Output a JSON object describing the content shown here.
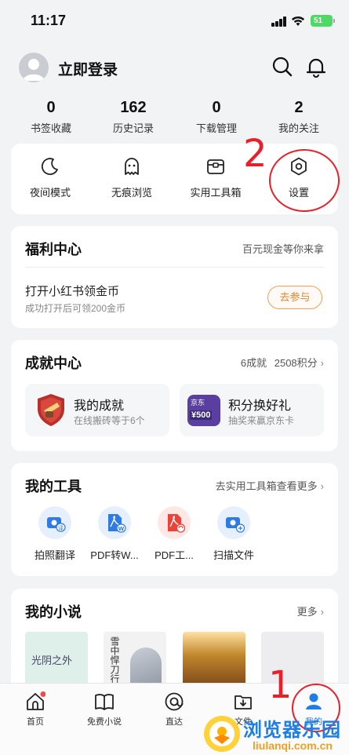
{
  "status_bar": {
    "time": "11:17",
    "battery": "51"
  },
  "header": {
    "login_label": "立即登录"
  },
  "stats": [
    {
      "num": "0",
      "label": "书签收藏"
    },
    {
      "num": "162",
      "label": "历史记录"
    },
    {
      "num": "0",
      "label": "下载管理"
    },
    {
      "num": "2",
      "label": "我的关注"
    }
  ],
  "quick": [
    {
      "label": "夜间模式",
      "icon": "moon-icon"
    },
    {
      "label": "无痕浏览",
      "icon": "ghost-icon"
    },
    {
      "label": "实用工具箱",
      "icon": "toolbox-icon"
    },
    {
      "label": "设置",
      "icon": "settings-hexagon-icon"
    }
  ],
  "welfare": {
    "title": "福利中心",
    "right": "百元现金等你来拿",
    "task_title": "打开小红书领金币",
    "task_sub": "成功打开后可领200金币",
    "button": "去参与"
  },
  "achievements": {
    "title": "成就中心",
    "count": "6成就",
    "points": "2508积分",
    "items": [
      {
        "title": "我的成就",
        "sub": "在线搬砖等于6个"
      },
      {
        "title": "积分换好礼",
        "sub": "抽奖来赢京东卡",
        "card_brand": "京东",
        "card_value": "¥500"
      }
    ]
  },
  "tools": {
    "title": "我的工具",
    "right": "去实用工具箱查看更多",
    "items": [
      {
        "label": "拍照翻译",
        "badge": "译",
        "icon": "camera-translate-icon"
      },
      {
        "label": "PDF转W...",
        "badge": "W",
        "icon": "pdf-to-word-icon"
      },
      {
        "label": "PDF工...",
        "badge": "",
        "icon": "pdf-tools-icon"
      },
      {
        "label": "扫描文件",
        "badge": "",
        "icon": "scan-file-icon"
      }
    ]
  },
  "novels": {
    "title": "我的小说",
    "right": "更多",
    "books": [
      {
        "title": "光阴之外"
      },
      {
        "title": "雪中悍刀行"
      },
      {
        "title": ""
      },
      {
        "title": ""
      }
    ]
  },
  "tabbar": [
    {
      "label": "首页",
      "icon": "home-icon"
    },
    {
      "label": "免费小说",
      "icon": "book-icon"
    },
    {
      "label": "直达",
      "icon": "direct-icon"
    },
    {
      "label": "文件",
      "icon": "download-folder-icon"
    },
    {
      "label": "我的",
      "icon": "profile-icon"
    }
  ],
  "annotations": {
    "mark_1": "1",
    "mark_2": "2"
  },
  "watermark": {
    "main": "浏览器乐园",
    "sub": "liulanqi.com.cn"
  },
  "colors": {
    "accent": "#1e7de6",
    "annotation": "#e8202a",
    "join_button": "#e8862e"
  }
}
